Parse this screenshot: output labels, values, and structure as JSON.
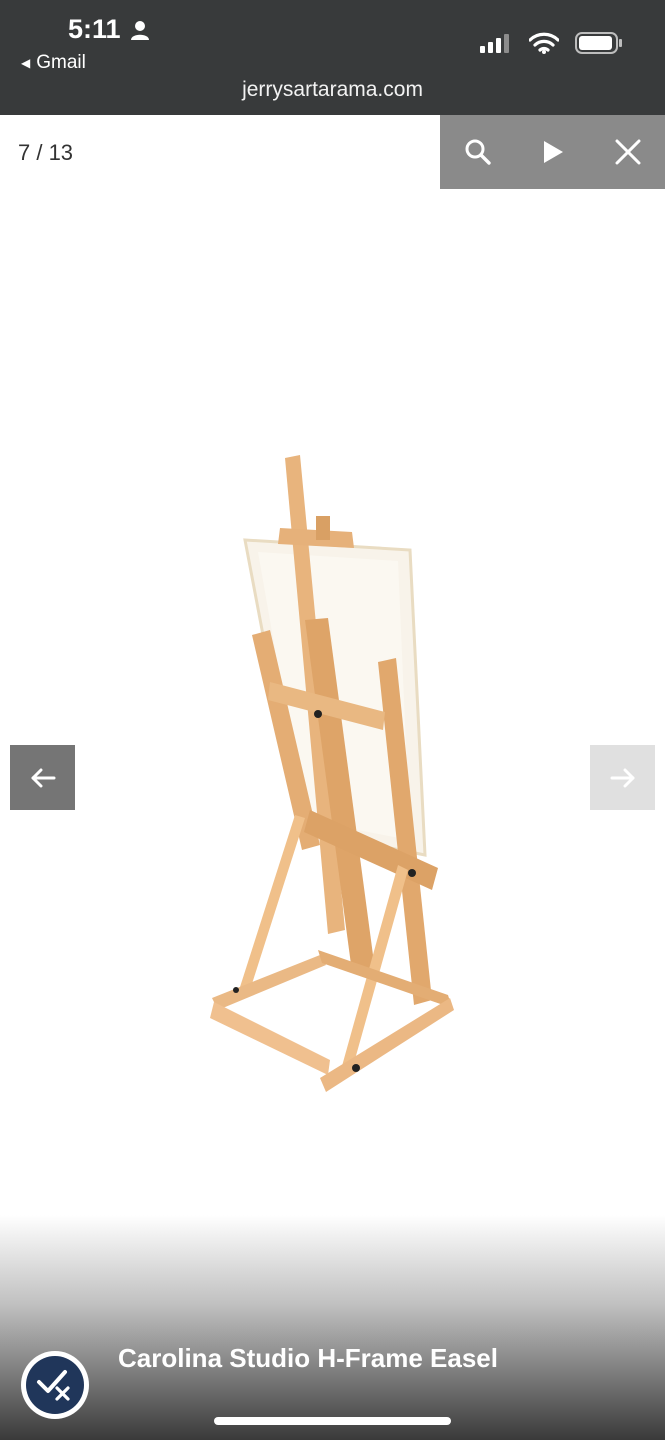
{
  "status_bar": {
    "time": "5:11",
    "back_app": "Gmail",
    "url": "jerrysartarama.com",
    "icons": [
      "person-icon",
      "signal-icon",
      "wifi-icon",
      "battery-icon"
    ]
  },
  "gallery": {
    "counter": "7 / 13",
    "toolbar": [
      "search-icon",
      "play-icon",
      "close-icon"
    ],
    "prev_icon": "arrow-left-icon",
    "next_icon": "arrow-right-icon",
    "image": "wooden-h-frame-easel-with-canvas",
    "caption": "Carolina Studio H-Frame Easel"
  },
  "colors": {
    "status_bar_bg": "#383a3b",
    "toolbar_bg": "#8a8a8a",
    "prev_bg": "#757575",
    "next_bg": "#e0e0e0",
    "badge": "#20365a",
    "wood": "#e7b27a"
  }
}
